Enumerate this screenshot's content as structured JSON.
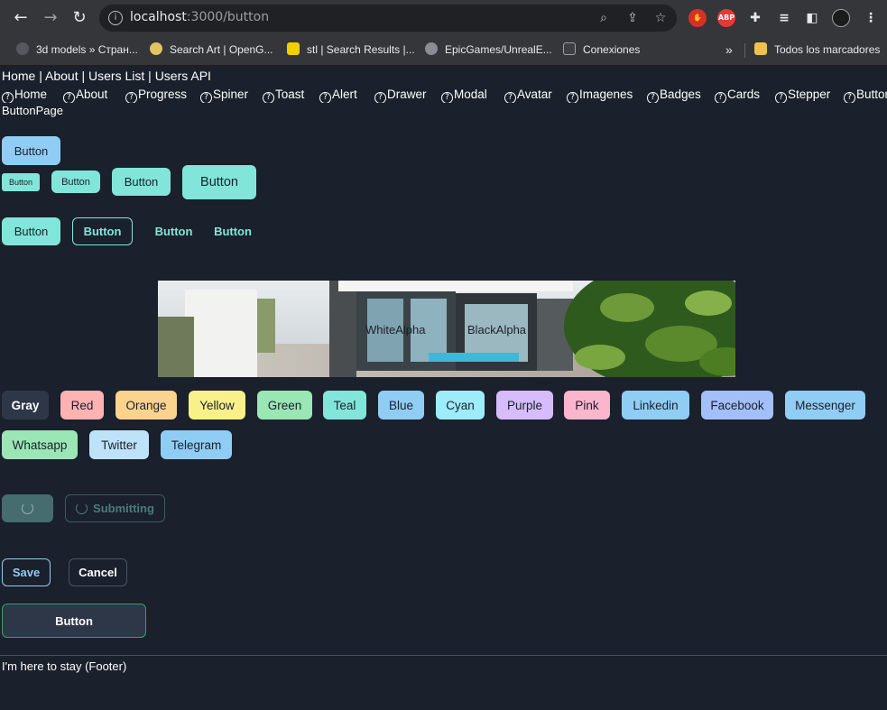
{
  "browser": {
    "url_host": "localhost",
    "url_path": ":3000/button",
    "bookmarks": [
      "3d models » Стран...",
      "Search Art | OpenG...",
      "stl | Search Results |...",
      "EpicGames/UnrealE...",
      "Conexiones",
      "Todos los marcadores"
    ],
    "overflow": "»",
    "ext_abp": "ABP"
  },
  "nav": {
    "links": [
      "Home",
      "About",
      "Users List",
      "Users API"
    ],
    "separator": " | ",
    "routes": [
      "Home",
      "About",
      "Progress",
      "Spiner",
      "Toast",
      "Alert",
      "Drawer",
      "Modal",
      "Avatar",
      "Imagenes",
      "Badges",
      "Cards",
      "Stepper",
      "Button"
    ]
  },
  "page": {
    "title": "ButtonPage",
    "button_default": "Button",
    "sizes": [
      "Button",
      "Button",
      "Button",
      "Button"
    ],
    "variants": [
      "Button",
      "Button",
      "Button",
      "Button"
    ],
    "hero_labels": [
      "WhiteAlpha",
      "BlackAlpha"
    ],
    "color_buttons": [
      {
        "label": "Gray",
        "bg": "#2d3748",
        "fg": "#ffffff"
      },
      {
        "label": "Red",
        "bg": "#feb2b2",
        "fg": "#1a202c"
      },
      {
        "label": "Orange",
        "bg": "#fbd38d",
        "fg": "#1a202c"
      },
      {
        "label": "Yellow",
        "bg": "#faf089",
        "fg": "#1a202c"
      },
      {
        "label": "Green",
        "bg": "#9ae6b4",
        "fg": "#1a202c"
      },
      {
        "label": "Teal",
        "bg": "#81e6d9",
        "fg": "#1a202c"
      },
      {
        "label": "Blue",
        "bg": "#90cdf4",
        "fg": "#1a202c"
      },
      {
        "label": "Cyan",
        "bg": "#9decf9",
        "fg": "#1a202c"
      },
      {
        "label": "Purple",
        "bg": "#d6bcfa",
        "fg": "#1a202c"
      },
      {
        "label": "Pink",
        "bg": "#fbb6ce",
        "fg": "#1a202c"
      },
      {
        "label": "Linkedin",
        "bg": "#90cdf4",
        "fg": "#1a202c"
      },
      {
        "label": "Facebook",
        "bg": "#a3bffa",
        "fg": "#1a202c"
      },
      {
        "label": "Messenger",
        "bg": "#90cdf4",
        "fg": "#1a202c"
      },
      {
        "label": "Whatsapp",
        "bg": "#9ae6b4",
        "fg": "#1a202c"
      },
      {
        "label": "Twitter",
        "bg": "#bee3f8",
        "fg": "#1a202c"
      },
      {
        "label": "Telegram",
        "bg": "#90cdf4",
        "fg": "#1a202c"
      }
    ],
    "submitting_label": "Submitting",
    "save_label": "Save",
    "cancel_label": "Cancel",
    "wide_button_label": "Button",
    "footer": "I'm here to stay (Footer)"
  }
}
